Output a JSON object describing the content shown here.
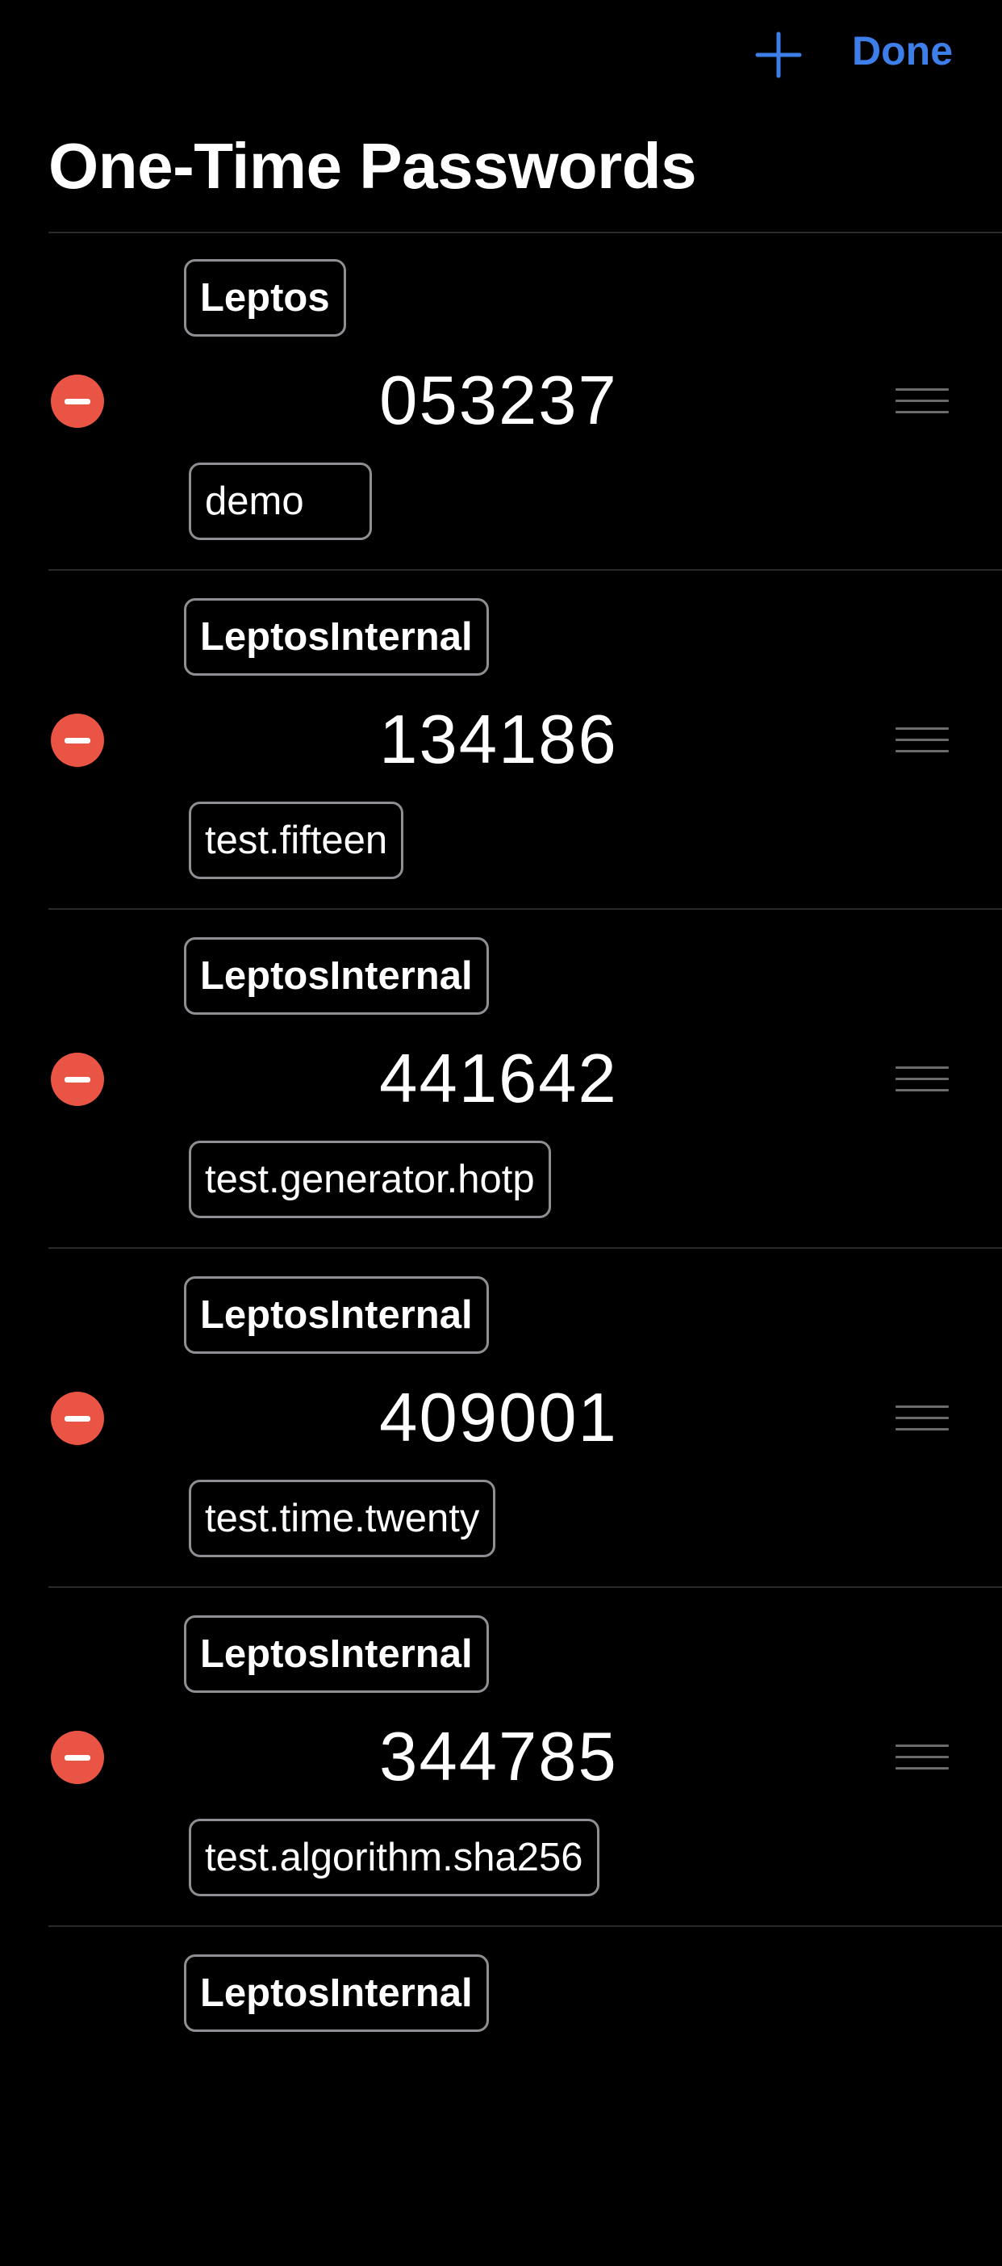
{
  "navbar": {
    "add_icon": "plus-icon",
    "done_label": "Done",
    "accent_color": "#3d7ee8"
  },
  "page": {
    "title": "One-Time Passwords"
  },
  "colors": {
    "delete": "#ea5444",
    "background": "#000000"
  },
  "items": [
    {
      "issuer": "Leptos",
      "code": "053237",
      "account": "demo"
    },
    {
      "issuer": "LeptosInternal",
      "code": "134186",
      "account": "test.fifteen"
    },
    {
      "issuer": "LeptosInternal",
      "code": "441642",
      "account": "test.generator.hotp"
    },
    {
      "issuer": "LeptosInternal",
      "code": "409001",
      "account": "test.time.twenty"
    },
    {
      "issuer": "LeptosInternal",
      "code": "344785",
      "account": "test.algorithm.sha256"
    },
    {
      "issuer": "LeptosInternal",
      "code": "",
      "account": ""
    }
  ]
}
